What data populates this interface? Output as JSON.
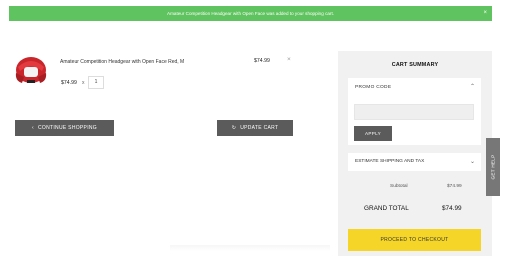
{
  "notice": {
    "message": "Amateur Competition Headgear with Open Face was added to your shopping cart.",
    "close_symbol": "×"
  },
  "cart_item": {
    "image_icon": "red-headgear-icon",
    "name": "Amateur Competition Headgear with Open Face Red, M",
    "unit_price": "$74.99",
    "times_symbol": "x",
    "quantity": "1",
    "line_total": "$74.99",
    "remove_symbol": "×"
  },
  "actions": {
    "continue_label": "CONTINUE SHOPPING",
    "continue_icon": "‹",
    "update_label": "UPDATE CART",
    "update_icon": "↻"
  },
  "summary": {
    "title": "CART SUMMARY",
    "promo_label": "PROMO CODE",
    "promo_chevron": "⌃",
    "promo_value": "",
    "apply_label": "APPLY",
    "shipping_label": "ESTIMATE SHIPPING AND TAX",
    "shipping_chevron": "⌄",
    "subtotal_label": "Subtotal",
    "subtotal_value": "$74.99",
    "grand_total_label": "GRAND TOTAL",
    "grand_total_value": "$74.99",
    "checkout_label": "PROCEED TO CHECKOUT"
  },
  "help": {
    "label": "GET HELP"
  },
  "colors": {
    "notice_bg": "#5fc35f",
    "button_dark": "#5b5b5b",
    "checkout": "#f5d628",
    "summary_bg": "#f1f1f1"
  }
}
